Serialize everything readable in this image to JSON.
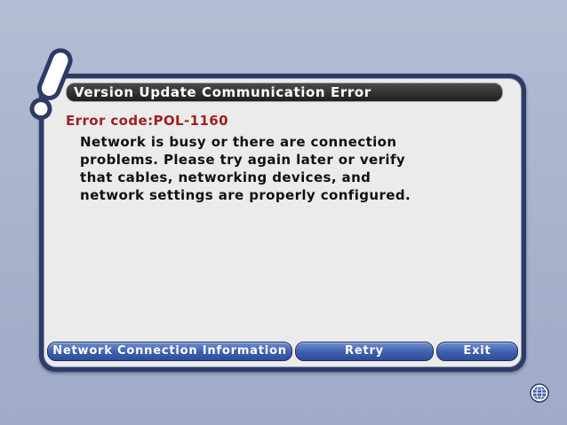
{
  "dialog": {
    "title": "Version Update Communication Error",
    "error_code": "Error code:POL-1160",
    "message": "Network is busy or there are connection problems. Please try again later or verify that cables, networking devices, and network settings are properly configured."
  },
  "buttons": {
    "network_info": "Network Connection Information",
    "retry": "Retry",
    "exit": "Exit"
  },
  "icons": {
    "alert": "exclamation-icon",
    "network": "globe-icon"
  },
  "colors": {
    "frame": "#2d3b66",
    "panel": "#ebebeb",
    "error_code": "#a02020",
    "button": "#3f5fae"
  }
}
